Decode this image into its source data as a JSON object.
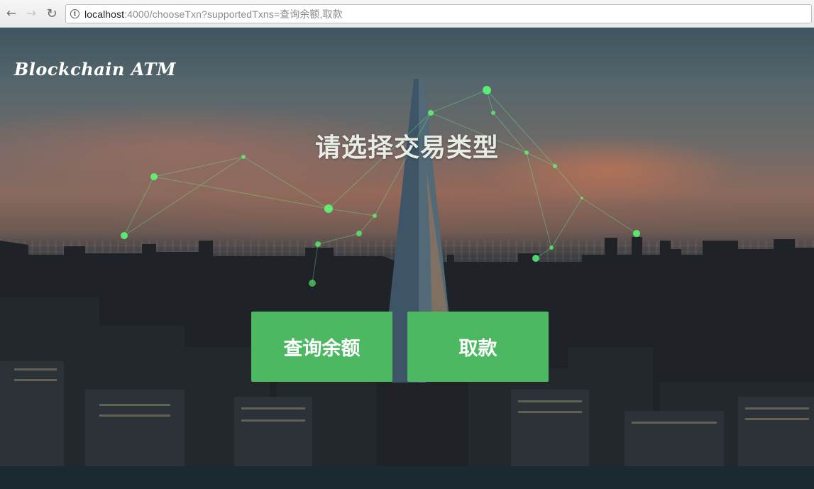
{
  "browser": {
    "url_host": "localhost",
    "url_rest": ":4000/chooseTxn?supportedTxns=查询余额,取款",
    "icons": {
      "back": "arrow-left-icon",
      "forward": "arrow-right-icon",
      "reload": "reload-icon",
      "info": "info-icon"
    }
  },
  "page": {
    "brand": "Blockchain ATM",
    "title": "请选择交易类型",
    "buttons": [
      {
        "label": "查询余额"
      },
      {
        "label": "取款"
      }
    ],
    "colors": {
      "button_bg": "#4cb862",
      "button_text": "#ffffff",
      "title_text": "#e9ece6",
      "network_glow": "#5dff78"
    }
  }
}
